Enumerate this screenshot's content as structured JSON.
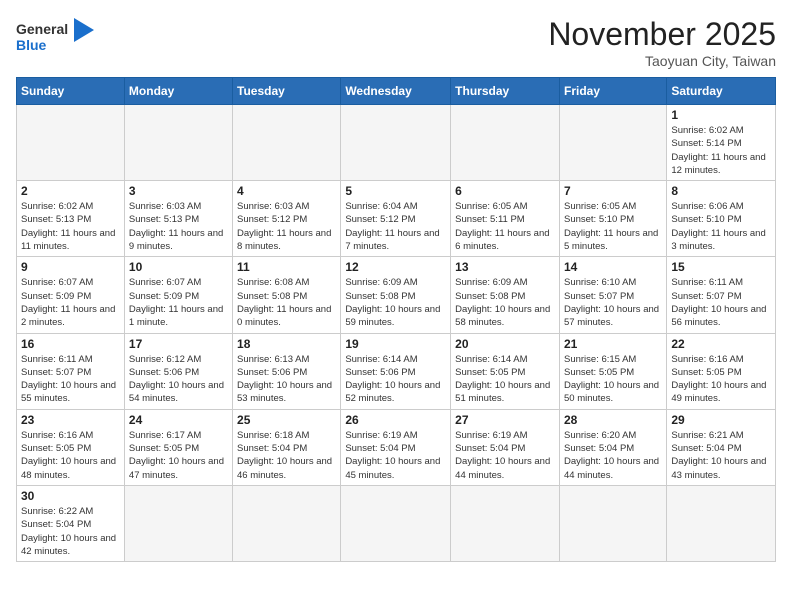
{
  "header": {
    "logo_general": "General",
    "logo_blue": "Blue",
    "month_title": "November 2025",
    "location": "Taoyuan City, Taiwan"
  },
  "weekdays": [
    "Sunday",
    "Monday",
    "Tuesday",
    "Wednesday",
    "Thursday",
    "Friday",
    "Saturday"
  ],
  "weeks": [
    [
      {
        "day": "",
        "info": ""
      },
      {
        "day": "",
        "info": ""
      },
      {
        "day": "",
        "info": ""
      },
      {
        "day": "",
        "info": ""
      },
      {
        "day": "",
        "info": ""
      },
      {
        "day": "",
        "info": ""
      },
      {
        "day": "1",
        "info": "Sunrise: 6:02 AM\nSunset: 5:14 PM\nDaylight: 11 hours and 12 minutes."
      }
    ],
    [
      {
        "day": "2",
        "info": "Sunrise: 6:02 AM\nSunset: 5:13 PM\nDaylight: 11 hours and 11 minutes."
      },
      {
        "day": "3",
        "info": "Sunrise: 6:03 AM\nSunset: 5:13 PM\nDaylight: 11 hours and 9 minutes."
      },
      {
        "day": "4",
        "info": "Sunrise: 6:03 AM\nSunset: 5:12 PM\nDaylight: 11 hours and 8 minutes."
      },
      {
        "day": "5",
        "info": "Sunrise: 6:04 AM\nSunset: 5:12 PM\nDaylight: 11 hours and 7 minutes."
      },
      {
        "day": "6",
        "info": "Sunrise: 6:05 AM\nSunset: 5:11 PM\nDaylight: 11 hours and 6 minutes."
      },
      {
        "day": "7",
        "info": "Sunrise: 6:05 AM\nSunset: 5:10 PM\nDaylight: 11 hours and 5 minutes."
      },
      {
        "day": "8",
        "info": "Sunrise: 6:06 AM\nSunset: 5:10 PM\nDaylight: 11 hours and 3 minutes."
      }
    ],
    [
      {
        "day": "9",
        "info": "Sunrise: 6:07 AM\nSunset: 5:09 PM\nDaylight: 11 hours and 2 minutes."
      },
      {
        "day": "10",
        "info": "Sunrise: 6:07 AM\nSunset: 5:09 PM\nDaylight: 11 hours and 1 minute."
      },
      {
        "day": "11",
        "info": "Sunrise: 6:08 AM\nSunset: 5:08 PM\nDaylight: 11 hours and 0 minutes."
      },
      {
        "day": "12",
        "info": "Sunrise: 6:09 AM\nSunset: 5:08 PM\nDaylight: 10 hours and 59 minutes."
      },
      {
        "day": "13",
        "info": "Sunrise: 6:09 AM\nSunset: 5:08 PM\nDaylight: 10 hours and 58 minutes."
      },
      {
        "day": "14",
        "info": "Sunrise: 6:10 AM\nSunset: 5:07 PM\nDaylight: 10 hours and 57 minutes."
      },
      {
        "day": "15",
        "info": "Sunrise: 6:11 AM\nSunset: 5:07 PM\nDaylight: 10 hours and 56 minutes."
      }
    ],
    [
      {
        "day": "16",
        "info": "Sunrise: 6:11 AM\nSunset: 5:07 PM\nDaylight: 10 hours and 55 minutes."
      },
      {
        "day": "17",
        "info": "Sunrise: 6:12 AM\nSunset: 5:06 PM\nDaylight: 10 hours and 54 minutes."
      },
      {
        "day": "18",
        "info": "Sunrise: 6:13 AM\nSunset: 5:06 PM\nDaylight: 10 hours and 53 minutes."
      },
      {
        "day": "19",
        "info": "Sunrise: 6:14 AM\nSunset: 5:06 PM\nDaylight: 10 hours and 52 minutes."
      },
      {
        "day": "20",
        "info": "Sunrise: 6:14 AM\nSunset: 5:05 PM\nDaylight: 10 hours and 51 minutes."
      },
      {
        "day": "21",
        "info": "Sunrise: 6:15 AM\nSunset: 5:05 PM\nDaylight: 10 hours and 50 minutes."
      },
      {
        "day": "22",
        "info": "Sunrise: 6:16 AM\nSunset: 5:05 PM\nDaylight: 10 hours and 49 minutes."
      }
    ],
    [
      {
        "day": "23",
        "info": "Sunrise: 6:16 AM\nSunset: 5:05 PM\nDaylight: 10 hours and 48 minutes."
      },
      {
        "day": "24",
        "info": "Sunrise: 6:17 AM\nSunset: 5:05 PM\nDaylight: 10 hours and 47 minutes."
      },
      {
        "day": "25",
        "info": "Sunrise: 6:18 AM\nSunset: 5:04 PM\nDaylight: 10 hours and 46 minutes."
      },
      {
        "day": "26",
        "info": "Sunrise: 6:19 AM\nSunset: 5:04 PM\nDaylight: 10 hours and 45 minutes."
      },
      {
        "day": "27",
        "info": "Sunrise: 6:19 AM\nSunset: 5:04 PM\nDaylight: 10 hours and 44 minutes."
      },
      {
        "day": "28",
        "info": "Sunrise: 6:20 AM\nSunset: 5:04 PM\nDaylight: 10 hours and 44 minutes."
      },
      {
        "day": "29",
        "info": "Sunrise: 6:21 AM\nSunset: 5:04 PM\nDaylight: 10 hours and 43 minutes."
      }
    ],
    [
      {
        "day": "30",
        "info": "Sunrise: 6:22 AM\nSunset: 5:04 PM\nDaylight: 10 hours and 42 minutes."
      },
      {
        "day": "",
        "info": ""
      },
      {
        "day": "",
        "info": ""
      },
      {
        "day": "",
        "info": ""
      },
      {
        "day": "",
        "info": ""
      },
      {
        "day": "",
        "info": ""
      },
      {
        "day": "",
        "info": ""
      }
    ]
  ]
}
